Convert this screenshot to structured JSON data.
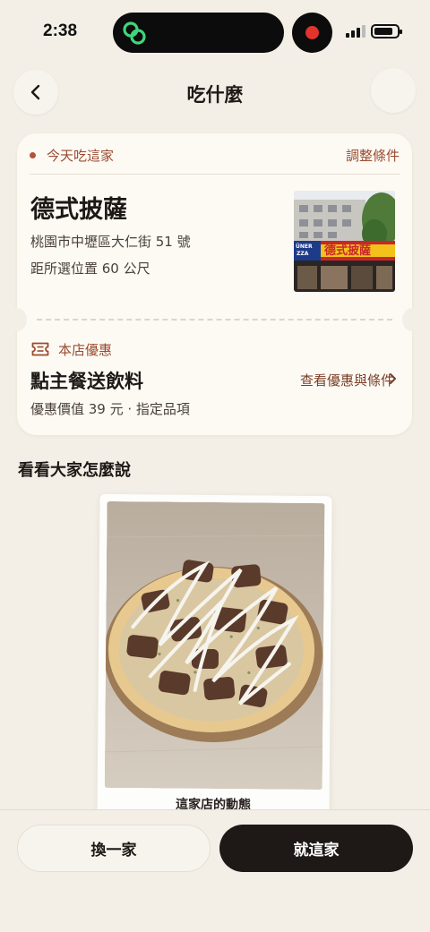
{
  "status_bar": {
    "time": "2:38"
  },
  "nav": {
    "title": "吃什麼"
  },
  "recommendation": {
    "tag": "今天吃這家",
    "adjust_link": "調整條件",
    "shop_name": "德式披薩",
    "address": "桃園市中壢區大仁街 51 號",
    "distance": "距所選位置 60 公尺",
    "photo_sign_text": "德式披薩",
    "photo_sign_left": "ÜNER\nZZA"
  },
  "deal": {
    "label": "本店優惠",
    "title": "點主餐送飲料",
    "link": "查看優惠與條件",
    "subtitle": "優惠價值 39 元 · 指定品項"
  },
  "reviews": {
    "section_title": "看看大家怎麼說",
    "caption": "這家店的動態"
  },
  "actions": {
    "skip_label": "換一家",
    "go_label": "就這家"
  },
  "colors": {
    "accent": "#9a4b30",
    "background": "#f3efe6",
    "card": "#fdfaf4",
    "primary_button": "#1e1816"
  }
}
